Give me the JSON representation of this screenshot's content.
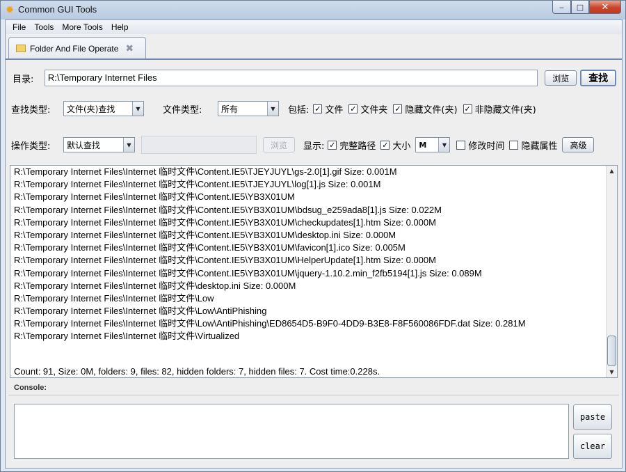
{
  "window": {
    "title": "Common GUI Tools",
    "minimize": "‒",
    "maximize": "□",
    "close": "✕"
  },
  "menu": [
    "File",
    "Tools",
    "More Tools",
    "Help"
  ],
  "tab": {
    "label": "Folder And File Operate",
    "close": "✖"
  },
  "dir_row": {
    "label": "目录:",
    "value": "R:\\Temporary Internet Files",
    "browse_button": "浏览",
    "search_button": "查找"
  },
  "search_row": {
    "search_type_label": "查找类型:",
    "search_type_value": "文件(夹)查找",
    "file_type_label": "文件类型:",
    "file_type_value": "所有",
    "include_label": "包括:",
    "options": [
      {
        "label": "文件",
        "checked": true
      },
      {
        "label": "文件夹",
        "checked": true
      },
      {
        "label": "隐藏文件(夹)",
        "checked": true
      },
      {
        "label": "非隐藏文件(夹)",
        "checked": true
      }
    ]
  },
  "op_row": {
    "op_type_label": "操作类型:",
    "op_type_value": "默认查找",
    "disabled_field_value": "",
    "browse_button": "浏览",
    "display_label": "显示:",
    "display_options": [
      {
        "label": "完整路径",
        "checked": true
      },
      {
        "label": "大小",
        "checked": true
      }
    ],
    "size_unit_value": "M",
    "extra_options": [
      {
        "label": "修改时间",
        "checked": false
      },
      {
        "label": "隐藏属性",
        "checked": false
      }
    ],
    "advanced_button": "高级"
  },
  "results": [
    "R:\\Temporary Internet Files\\Internet 临时文件\\Content.IE5\\TJEYJUYL\\gs-2.0[1].gif  Size: 0.001M",
    "R:\\Temporary Internet Files\\Internet 临时文件\\Content.IE5\\TJEYJUYL\\log[1].js  Size: 0.001M",
    "R:\\Temporary Internet Files\\Internet 临时文件\\Content.IE5\\YB3X01UM",
    "R:\\Temporary Internet Files\\Internet 临时文件\\Content.IE5\\YB3X01UM\\bdsug_e259ada8[1].js  Size: 0.022M",
    "R:\\Temporary Internet Files\\Internet 临时文件\\Content.IE5\\YB3X01UM\\checkupdates[1].htm  Size: 0.000M",
    "R:\\Temporary Internet Files\\Internet 临时文件\\Content.IE5\\YB3X01UM\\desktop.ini  Size: 0.000M",
    "R:\\Temporary Internet Files\\Internet 临时文件\\Content.IE5\\YB3X01UM\\favicon[1].ico  Size: 0.005M",
    "R:\\Temporary Internet Files\\Internet 临时文件\\Content.IE5\\YB3X01UM\\HelperUpdate[1].htm  Size: 0.000M",
    "R:\\Temporary Internet Files\\Internet 临时文件\\Content.IE5\\YB3X01UM\\jquery-1.10.2.min_f2fb5194[1].js  Size: 0.089M",
    "R:\\Temporary Internet Files\\Internet 临时文件\\desktop.ini  Size: 0.000M",
    "R:\\Temporary Internet Files\\Internet 临时文件\\Low",
    "R:\\Temporary Internet Files\\Internet 临时文件\\Low\\AntiPhishing",
    "R:\\Temporary Internet Files\\Internet 临时文件\\Low\\AntiPhishing\\ED8654D5-B9F0-4DD9-B3E8-F8F560086FDF.dat  Size: 0.281M",
    "R:\\Temporary Internet Files\\Internet 临时文件\\Virtualized"
  ],
  "summary": "Count: 91, Size: 0M, folders: 9, files: 82, hidden folders: 7, hidden files: 7. Cost time:0.228s.",
  "console": {
    "label": "Console:",
    "text": "",
    "paste_button": "paste",
    "clear_button": "clear"
  },
  "icons": {
    "app": "gear-icon",
    "tab": "folder-icon",
    "dropdown": "chevron-down-icon",
    "scroll_up": "arrow-up-icon",
    "scroll_down": "arrow-down-icon"
  }
}
